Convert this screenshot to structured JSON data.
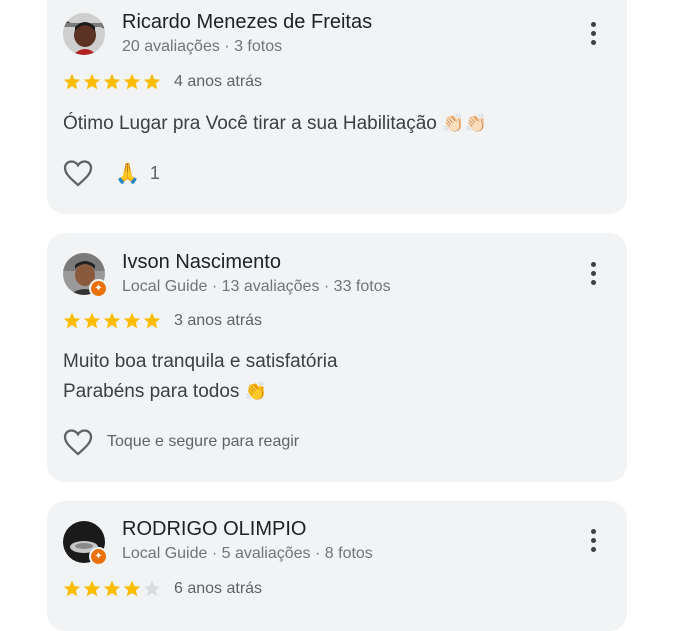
{
  "reviews": [
    {
      "name": "Ricardo Menezes de Freitas",
      "meta": "20 avaliações · 3 fotos",
      "stars": 5,
      "time": "4 anos atrás",
      "text_lines": [
        "Ótimo Lugar pra Você tirar a sua Habilitação"
      ],
      "text_emoji": "👏🏻👏🏻",
      "reaction_emoji": "🙏",
      "reaction_count": "1",
      "local_guide": false
    },
    {
      "name": "Ivson Nascimento",
      "meta": "Local Guide · 13 avaliações · 33 fotos",
      "stars": 5,
      "time": "3 anos atrás",
      "text_lines": [
        "Muito boa tranquila e satisfatória",
        "Parabéns para todos"
      ],
      "text_emoji": "👏",
      "action_hint": "Toque e segure para reagir",
      "local_guide": true
    },
    {
      "name": "RODRIGO OLIMPIO",
      "meta": "Local Guide · 5 avaliações · 8 fotos",
      "stars": 4,
      "time": "6 anos atrás",
      "local_guide": true
    }
  ],
  "colors": {
    "card_bg": "#f1f3f4",
    "star": "#fbbc04",
    "star_empty": "#dadce0",
    "guide_badge": "#e8710a"
  },
  "icons": [
    "more-vert-icon",
    "heart-outline-icon",
    "star-icon",
    "local-guide-badge-icon"
  ]
}
